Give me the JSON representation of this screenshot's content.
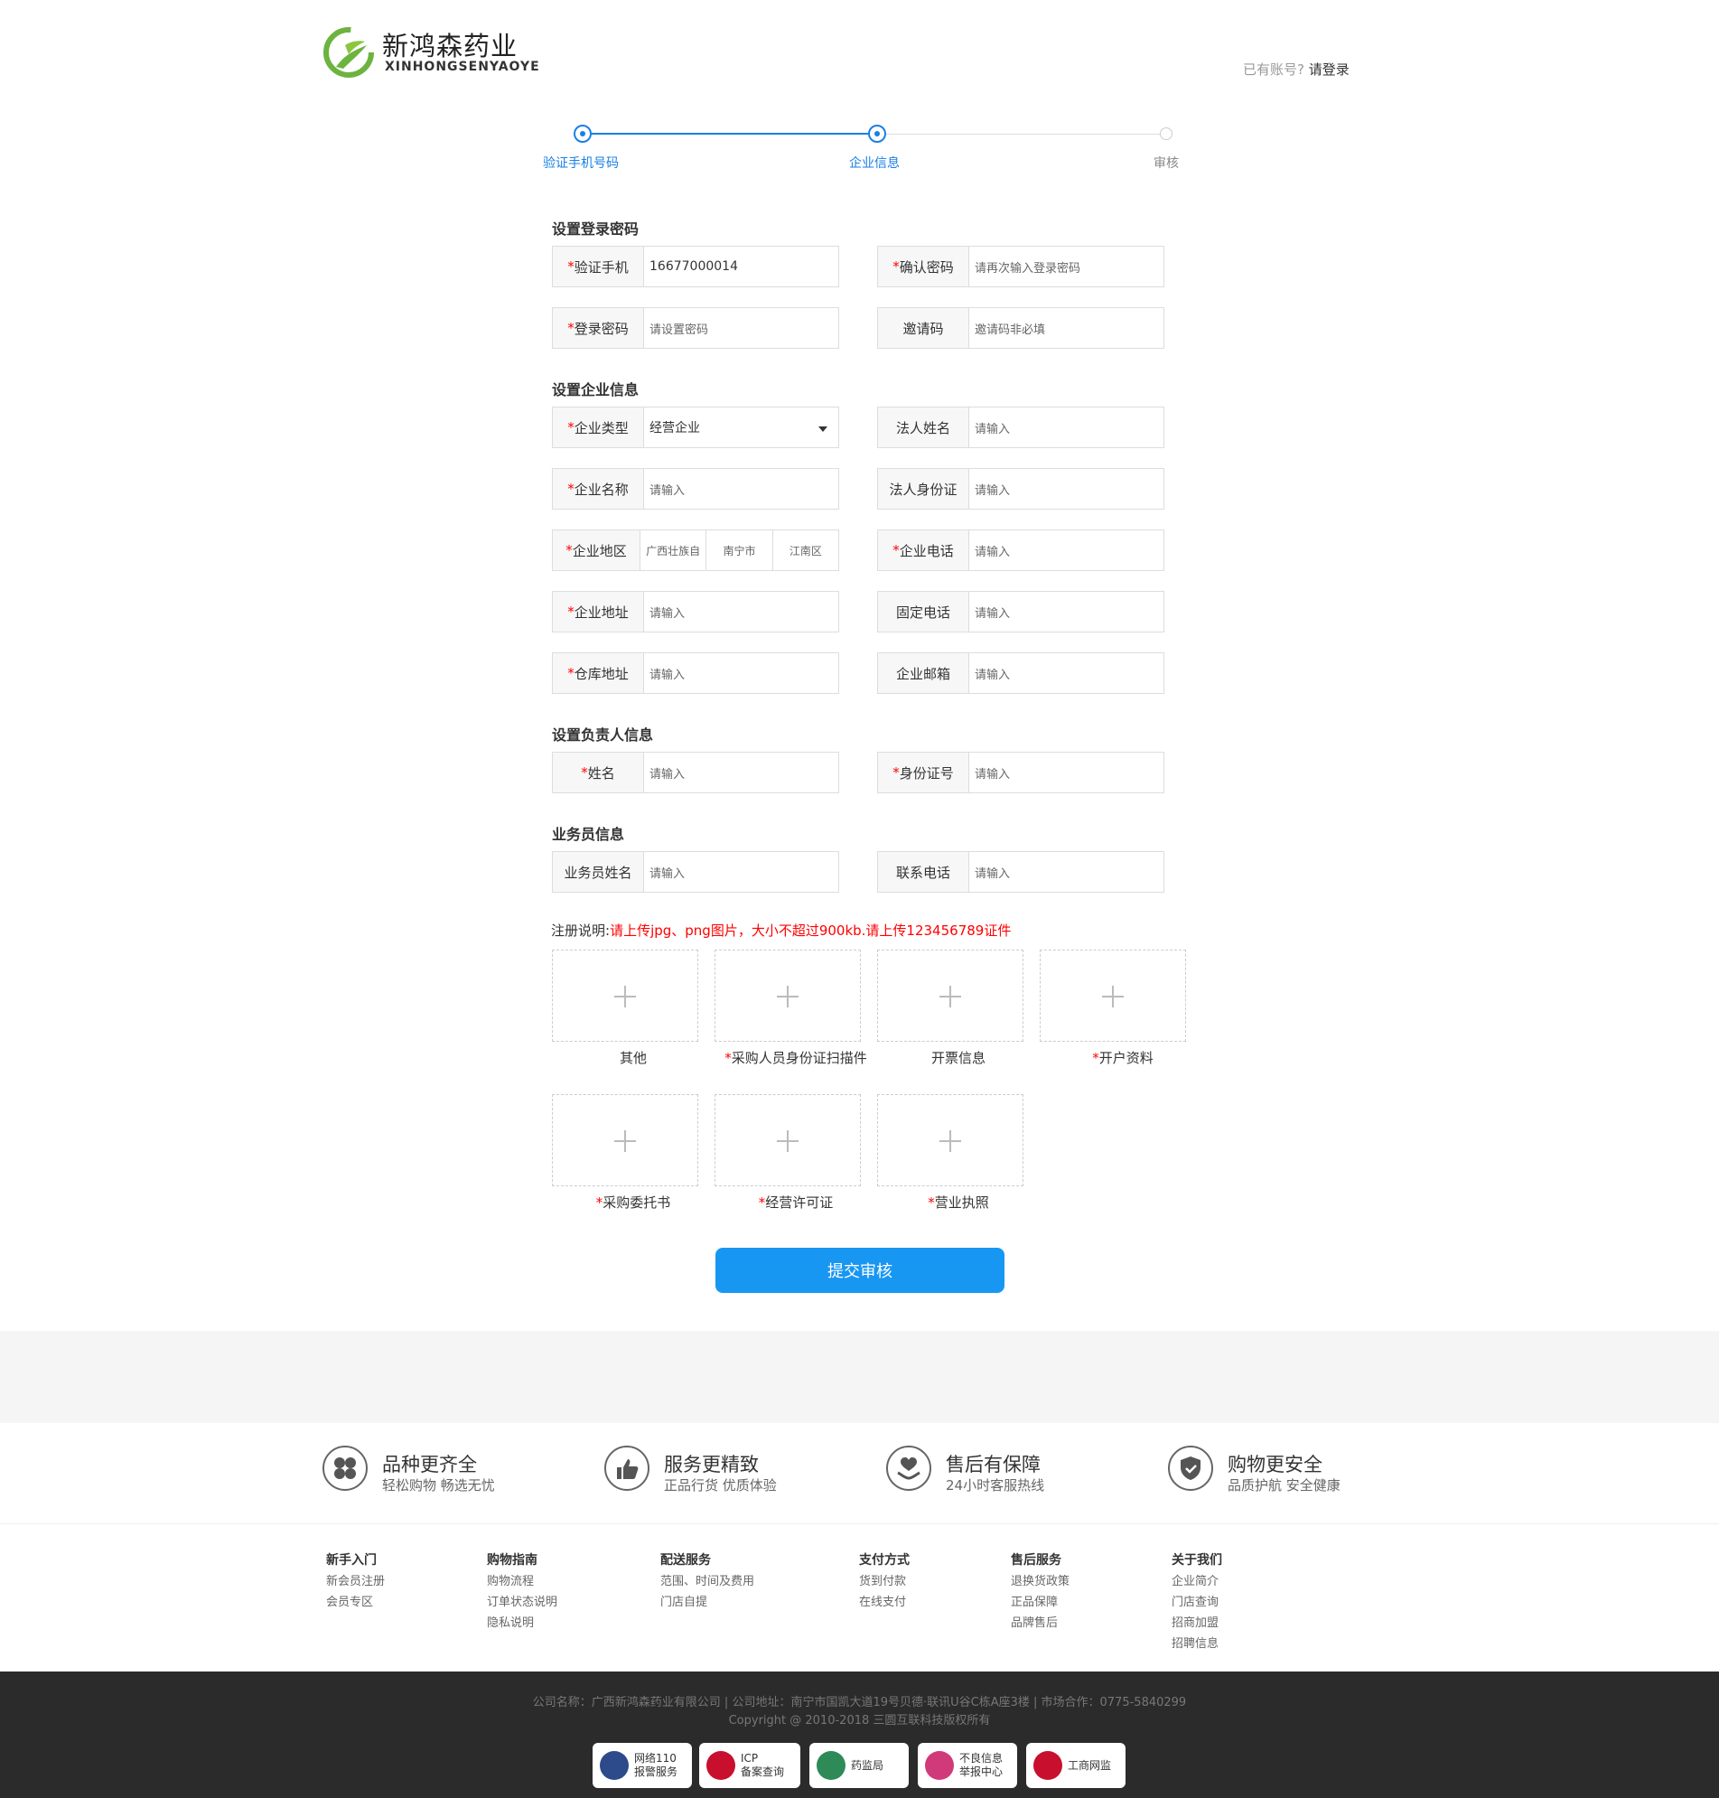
{
  "header": {
    "logo_cn": "新鸿森药业",
    "logo_en": "XINHONGSENYAOYE",
    "login_prompt": "已有账号?",
    "login_link": "请登录"
  },
  "steps": [
    {
      "label": "验证手机号码",
      "state": "done"
    },
    {
      "label": "企业信息",
      "state": "current"
    },
    {
      "label": "审核",
      "state": "todo"
    }
  ],
  "sections": {
    "password": "设置登录密码",
    "company": "设置企业信息",
    "owner": "设置负责人信息",
    "salesman": "业务员信息"
  },
  "fields": {
    "phone": {
      "label": "验证手机",
      "value": "16677000014"
    },
    "confirm_password": {
      "label": "确认密码",
      "placeholder": "请再次输入登录密码"
    },
    "password": {
      "label": "登录密码",
      "placeholder": "请设置密码"
    },
    "invite_code": {
      "label": "邀请码",
      "placeholder": "邀请码非必填"
    },
    "company_type": {
      "label": "企业类型",
      "value": "经营企业"
    },
    "legal_name": {
      "label": "法人姓名",
      "placeholder": "请输入"
    },
    "company_name": {
      "label": "企业名称",
      "placeholder": "请输入"
    },
    "legal_id": {
      "label": "法人身份证",
      "placeholder": "请输入"
    },
    "region": {
      "label": "企业地区",
      "province": "广西壮族自",
      "city": "南宁市",
      "district": "江南区"
    },
    "company_phone": {
      "label": "企业电话",
      "placeholder": "请输入"
    },
    "company_address": {
      "label": "企业地址",
      "placeholder": "请输入"
    },
    "landline": {
      "label": "固定电话",
      "placeholder": "请输入"
    },
    "warehouse_address": {
      "label": "仓库地址",
      "placeholder": "请输入"
    },
    "company_email": {
      "label": "企业邮箱",
      "placeholder": "请输入"
    },
    "owner_name": {
      "label": "姓名",
      "placeholder": "请输入"
    },
    "owner_id": {
      "label": "身份证号",
      "placeholder": "请输入"
    },
    "salesman_name": {
      "label": "业务员姓名",
      "placeholder": "请输入"
    },
    "salesman_phone": {
      "label": "联系电话",
      "placeholder": "请输入"
    }
  },
  "registration_note": {
    "label": "注册说明:",
    "text": "请上传jpg、png图片，大小不超过900kb.请上传123456789证件"
  },
  "uploads": [
    {
      "label": "其他",
      "required": false
    },
    {
      "label": "采购人员身份证扫描件",
      "required": true
    },
    {
      "label": "开票信息",
      "required": false
    },
    {
      "label": "开户资料",
      "required": true
    },
    {
      "label": "采购委托书",
      "required": true
    },
    {
      "label": "经营许可证",
      "required": true
    },
    {
      "label": "营业执照",
      "required": true
    }
  ],
  "submit_label": "提交审核",
  "features": [
    {
      "title": "品种更齐全",
      "sub": "轻松购物 畅选无忧",
      "icon": "clover-icon"
    },
    {
      "title": "服务更精致",
      "sub": "正品行货 优质体验",
      "icon": "thumbs-up-icon"
    },
    {
      "title": "售后有保障",
      "sub": "24小时客服热线",
      "icon": "heart-hands-icon"
    },
    {
      "title": "购物更安全",
      "sub": "品质护航 安全健康",
      "icon": "shield-icon"
    }
  ],
  "footer_columns": [
    {
      "title": "新手入门",
      "items": [
        "新会员注册",
        "会员专区"
      ]
    },
    {
      "title": "购物指南",
      "items": [
        "购物流程",
        "订单状态说明",
        "隐私说明"
      ]
    },
    {
      "title": "配送服务",
      "items": [
        "范围、时间及费用",
        "门店自提"
      ]
    },
    {
      "title": "支付方式",
      "items": [
        "货到付款",
        "在线支付"
      ]
    },
    {
      "title": "售后服务",
      "items": [
        "退换货政策",
        "正品保障",
        "品牌售后"
      ]
    },
    {
      "title": "关于我们",
      "items": [
        "企业简介",
        "门店查询",
        "招商加盟",
        "招聘信息"
      ]
    }
  ],
  "copyright": {
    "line1": "公司名称：广西新鸿森药业有限公司 | 公司地址：南宁市国凯大道19号贝德·联讯U谷C栋A座3楼 | 市场合作：0775-5840299",
    "line2": "Copyright @ 2010-2018 三圆互联科技版权所有"
  },
  "badges": [
    {
      "text": "网络110\n报警服务",
      "icon": "police-icon"
    },
    {
      "text": "ICP\n备案查询",
      "icon": "emblem-icon"
    },
    {
      "text": "药监局",
      "icon": "sfda-icon"
    },
    {
      "text": "不良信息\n举报中心",
      "icon": "report-icon"
    },
    {
      "text": "工商网监",
      "icon": "aic-icon"
    }
  ],
  "colors": {
    "accent": "#1897f2",
    "step": "#1a7fe6",
    "required": "#ff0000",
    "logo_green": "#6db33f"
  }
}
